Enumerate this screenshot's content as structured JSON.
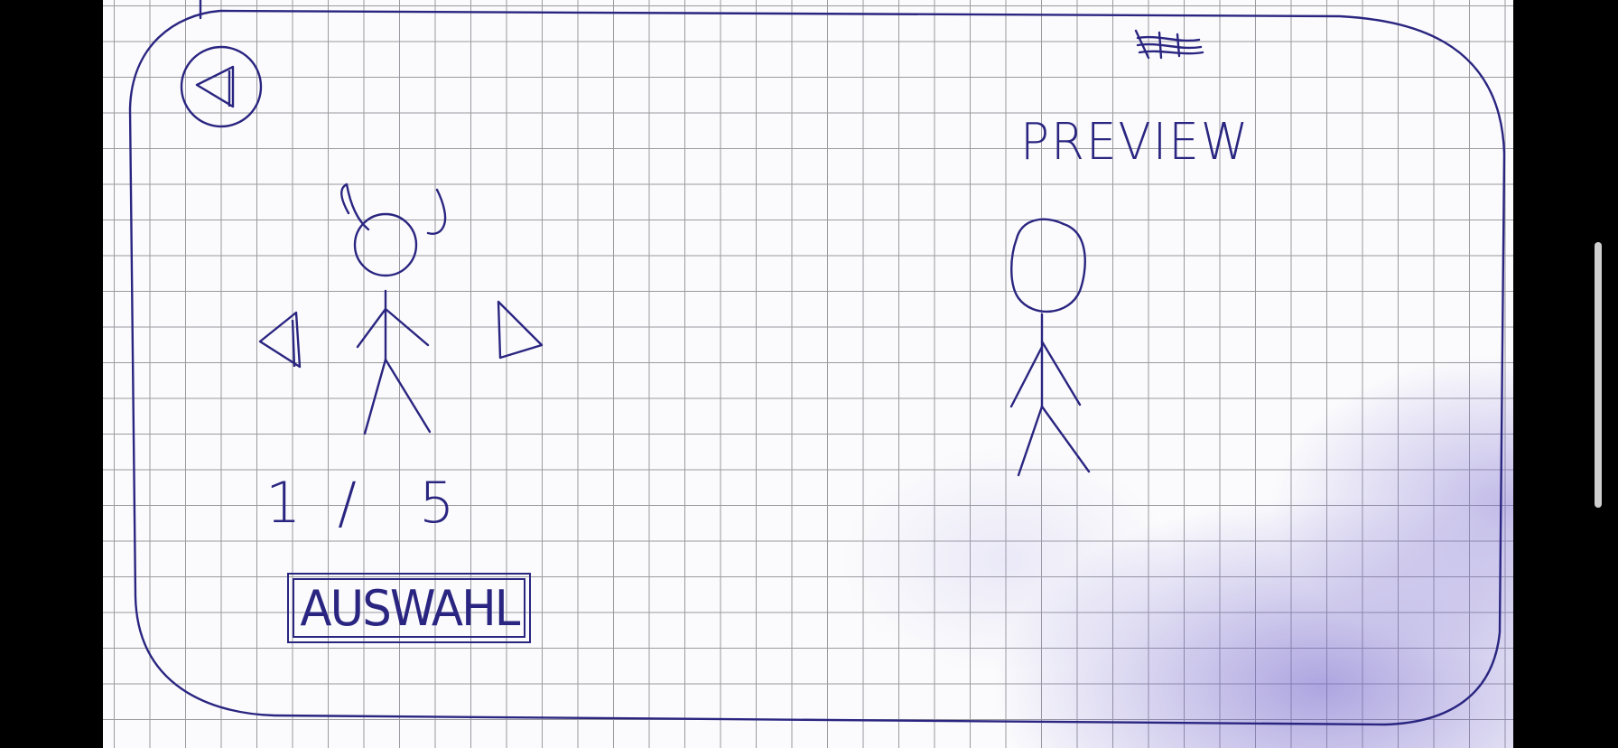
{
  "preview": {
    "label": "PREVIEW"
  },
  "character_selector": {
    "current": "1",
    "separator": "/",
    "total": "5"
  },
  "actions": {
    "select_label": "AUSWAHL"
  },
  "icons": {
    "back": "back-triangle-icon",
    "prev": "left-arrow-icon",
    "next": "right-arrow-icon",
    "scribble": "scribble-mark"
  },
  "colors": {
    "ink": "#2a2580",
    "paper": "#fbfbfd",
    "grid": "#9a9aa0"
  }
}
